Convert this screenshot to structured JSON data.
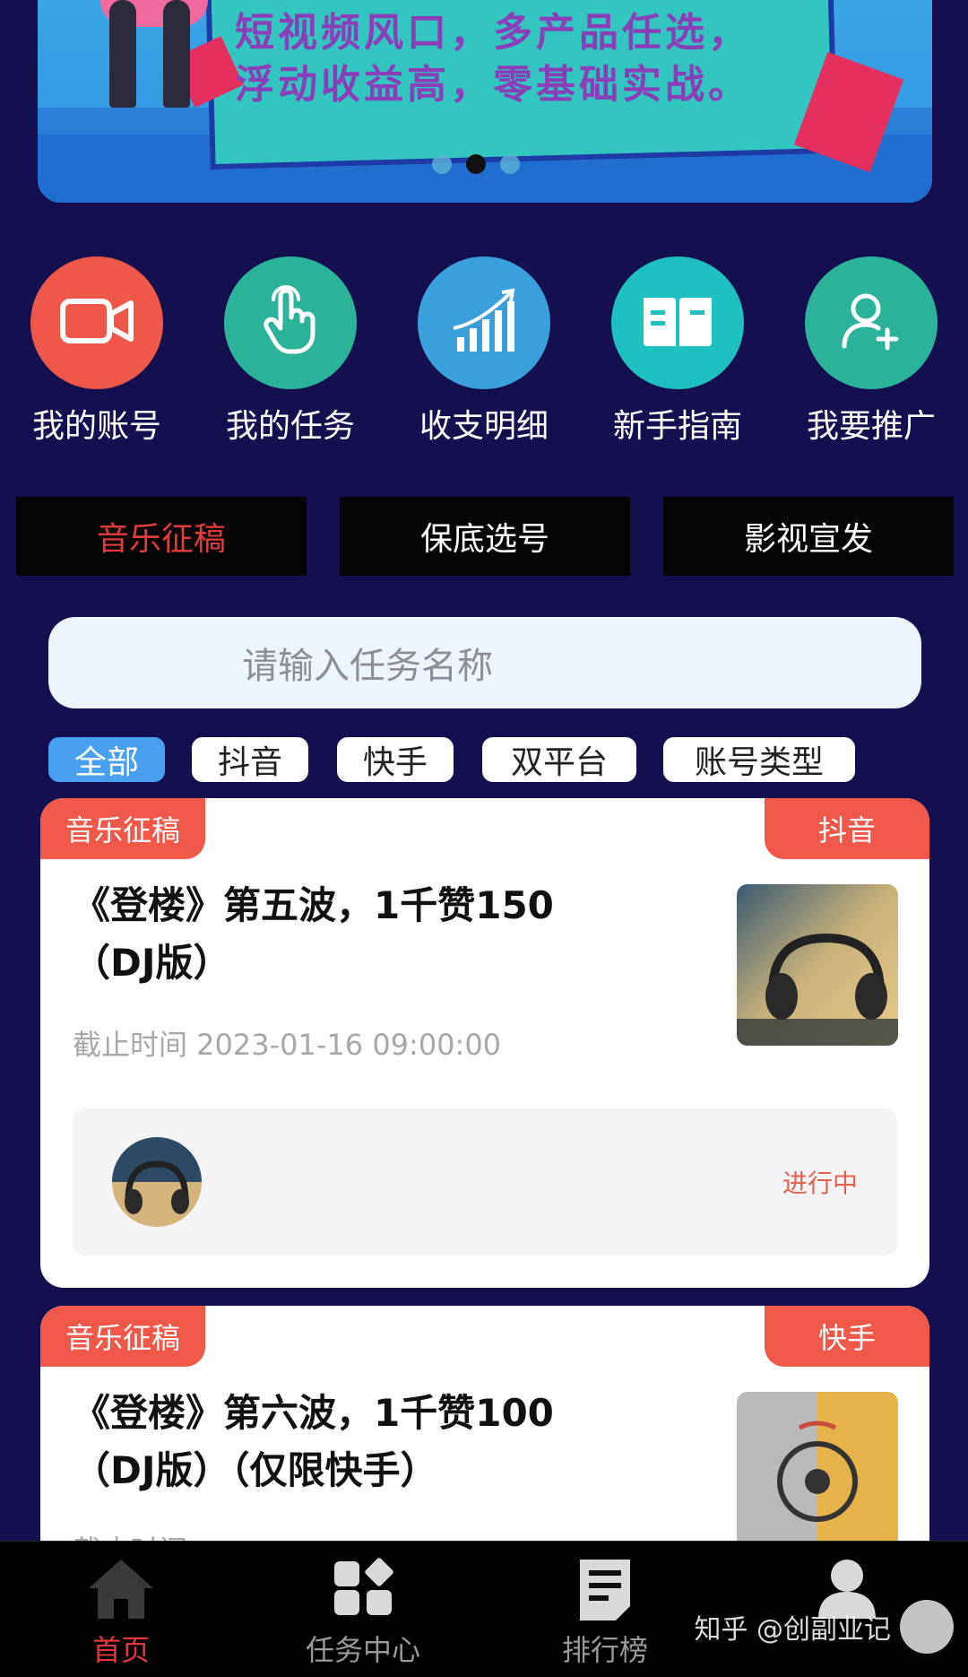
{
  "banner": {
    "text_line1": "短视频风口，多产品任选，",
    "text_line2": "浮动收益高，零基础实战。"
  },
  "quick_icons": [
    {
      "label": "我的账号",
      "icon": "video-camera-icon",
      "color": "#ef5848"
    },
    {
      "label": "我的任务",
      "icon": "touch-hand-icon",
      "color": "#2bb39a"
    },
    {
      "label": "收支明细",
      "icon": "bar-growth-icon",
      "color": "#3aa0dc"
    },
    {
      "label": "新手指南",
      "icon": "open-book-icon",
      "color": "#1fc0c0"
    },
    {
      "label": "我要推广",
      "icon": "add-user-icon",
      "color": "#2bb39a"
    }
  ],
  "categories": [
    {
      "label": "音乐征稿",
      "active": true
    },
    {
      "label": "保底选号",
      "active": false
    },
    {
      "label": "影视宣发",
      "active": false
    }
  ],
  "search": {
    "placeholder": "请输入任务名称"
  },
  "filters": [
    {
      "label": "全部",
      "active": true
    },
    {
      "label": "抖音",
      "active": false
    },
    {
      "label": "快手",
      "active": false
    },
    {
      "label": "双平台",
      "active": false
    },
    {
      "label": "账号类型",
      "active": false
    }
  ],
  "tasks": [
    {
      "category_tag": "音乐征稿",
      "platform_tag": "抖音",
      "title": "《登楼》第五波，1千赞150（DJ版）",
      "deadline": "截止时间 2023-01-16 09:00:00",
      "status": "进行中"
    },
    {
      "category_tag": "音乐征稿",
      "platform_tag": "快手",
      "title": "《登楼》第六波，1千赞100（DJ版）（仅限快手）",
      "deadline": "截止时间"
    }
  ],
  "nav": [
    {
      "label": "首页",
      "icon": "home-icon",
      "active": true
    },
    {
      "label": "任务中心",
      "icon": "grid-icon",
      "active": false
    },
    {
      "label": "排行榜",
      "icon": "document-icon",
      "active": false
    },
    {
      "label": "",
      "icon": "profile-icon",
      "active": false
    }
  ],
  "watermark": {
    "text": "知乎 @创副业记"
  }
}
